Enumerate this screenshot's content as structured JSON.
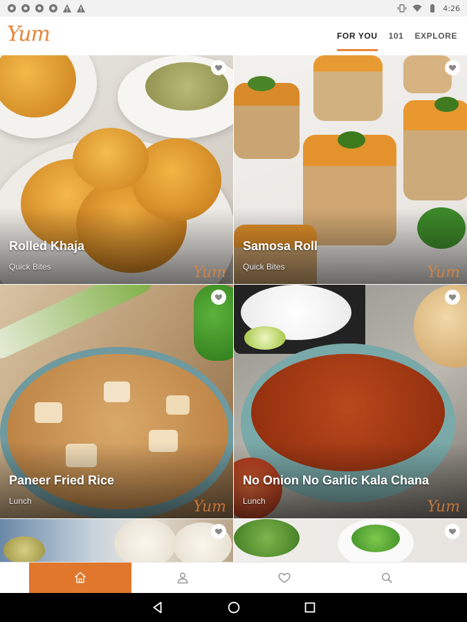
{
  "statusbar": {
    "time": "4:26"
  },
  "app": {
    "logo_text": "Yum",
    "accent": "#e0772d"
  },
  "tabs": [
    {
      "label": "FOR YOU",
      "active": true
    },
    {
      "label": "101",
      "active": false
    },
    {
      "label": "EXPLORE",
      "active": false
    }
  ],
  "cards": [
    {
      "title": "Rolled Khaja",
      "category": "Quick Bites"
    },
    {
      "title": "Samosa Roll",
      "category": "Quick Bites"
    },
    {
      "title": "Paneer Fried Rice",
      "category": "Lunch"
    },
    {
      "title": "No Onion No Garlic Kala Chana",
      "category": "Lunch"
    }
  ],
  "watermark": "Yum",
  "bottom_nav": [
    {
      "icon": "home-icon",
      "active": true
    },
    {
      "icon": "profile-icon",
      "active": false
    },
    {
      "icon": "heart-icon",
      "active": false
    },
    {
      "icon": "search-icon",
      "active": false
    }
  ]
}
